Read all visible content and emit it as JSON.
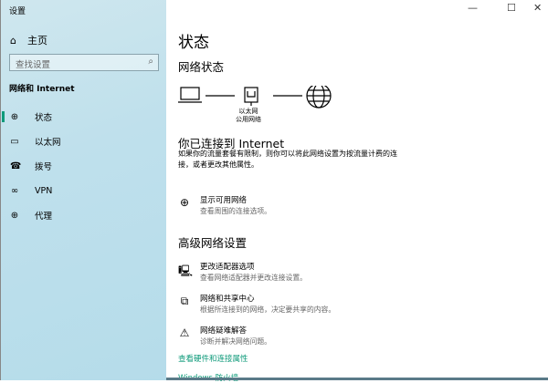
{
  "window": {
    "title": "设置",
    "controls": {
      "minimize": "—",
      "maximize": "☐",
      "close": "✕"
    }
  },
  "sidebar": {
    "home": "主页",
    "search_placeholder": "查找设置",
    "section": "网络和 Internet",
    "items": [
      {
        "label": "状态",
        "icon": "status-icon",
        "glyph": "⊕",
        "active": true
      },
      {
        "label": "以太网",
        "icon": "ethernet-icon",
        "glyph": "▭"
      },
      {
        "label": "拨号",
        "icon": "dialup-icon",
        "glyph": "☎"
      },
      {
        "label": "VPN",
        "icon": "vpn-icon",
        "glyph": "∞"
      },
      {
        "label": "代理",
        "icon": "proxy-icon",
        "glyph": "⊕"
      }
    ]
  },
  "main": {
    "title": "状态",
    "network_status": "网络状态",
    "adapter_name": "以太网",
    "network_type": "公用网络",
    "connected_title": "你已连接到 Internet",
    "connected_desc": "如果你的流量套餐有限制，则你可以将此网络设置为按流量计费的连接，或者更改其他属性。",
    "show_networks": {
      "title": "显示可用网络",
      "sub": "查看周围的连接选项。"
    },
    "advanced_title": "高级网络设置",
    "advanced": [
      {
        "title": "更改适配器选项",
        "sub": "查看网络适配器并更改连接设置。",
        "glyph": "🖳"
      },
      {
        "title": "网络和共享中心",
        "sub": "根据所连接到的网络，决定要共享的内容。",
        "glyph": "⧉"
      },
      {
        "title": "网络疑难解答",
        "sub": "诊断并解决网络问题。",
        "glyph": "⚠"
      }
    ],
    "links": [
      "查看硬件和连接属性",
      "Windows 防火墙"
    ]
  },
  "accent": "#0e9a7a"
}
